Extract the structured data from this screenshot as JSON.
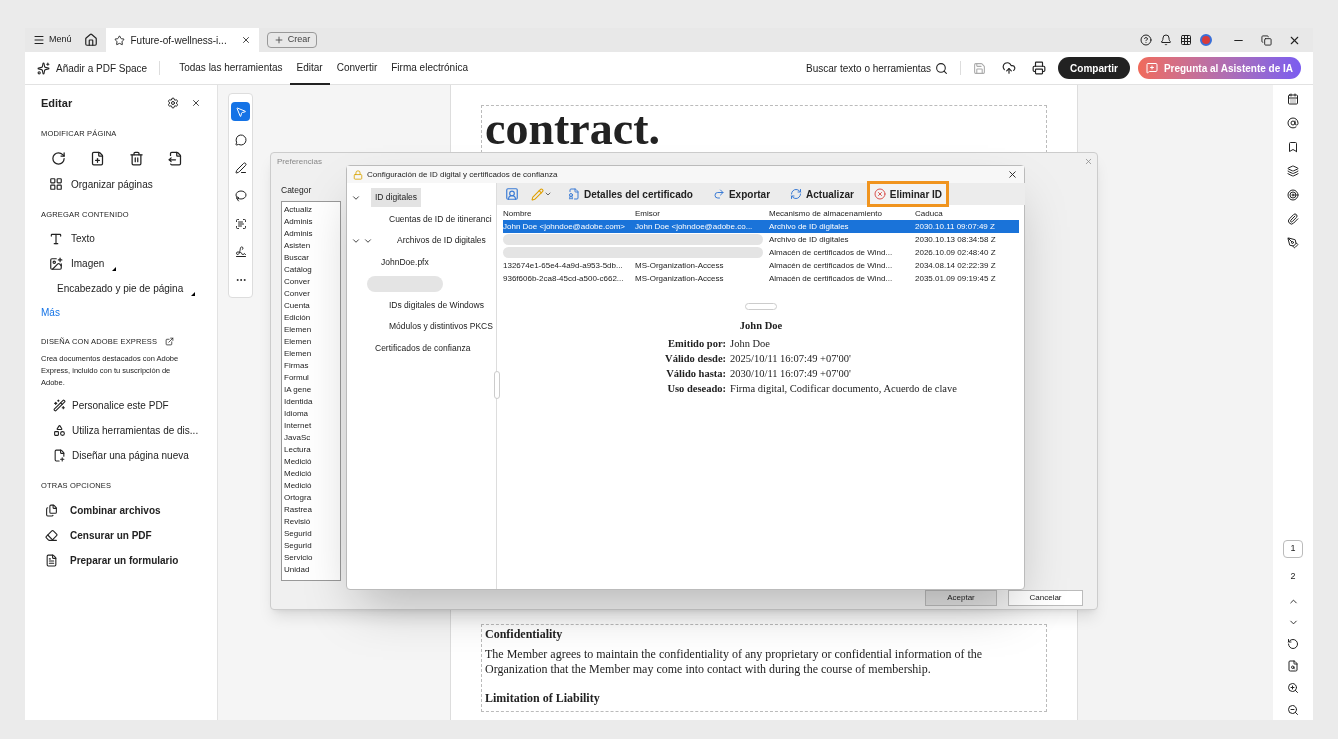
{
  "window": {
    "menu": "Menú",
    "tabs": [
      {
        "label": "Future-of-wellness-i...",
        "selected": true
      }
    ],
    "new_button": "Crear"
  },
  "toolbar": {
    "pdf_space": "Añadir a PDF Space",
    "nav": [
      {
        "label": "Todas las herramientas",
        "selected": false
      },
      {
        "label": "Editar",
        "selected": true
      },
      {
        "label": "Convertir",
        "selected": false
      },
      {
        "label": "Firma electrónica",
        "selected": false
      }
    ],
    "search": "Buscar texto o herramientas",
    "share": "Compartir",
    "assistant": "Pregunta al Asistente de IA"
  },
  "left_panel": {
    "title": "Editar",
    "sections": [
      {
        "heading": "MODIFICAR PÁGINA",
        "items": [
          {
            "kind": "icons"
          },
          {
            "kind": "tool",
            "label": "Organizar páginas",
            "submenu": false
          }
        ]
      },
      {
        "heading": "AGREGAR CONTENIDO",
        "items": [
          {
            "kind": "tool",
            "label": "Texto",
            "submenu": false
          },
          {
            "kind": "tool",
            "label": "Imagen",
            "submenu": true
          },
          {
            "kind": "tool",
            "label": "Encabezado y pie de página",
            "submenu": true
          },
          {
            "kind": "link",
            "label": "Más"
          }
        ]
      },
      {
        "heading": "DISEÑA CON ADOBE EXPRESS",
        "items": [
          {
            "kind": "note",
            "label": "Crea documentos destacados con Adobe Express, incluido con tu suscripción de Adobe."
          },
          {
            "kind": "indented",
            "label": "Personalice este PDF"
          },
          {
            "kind": "indented",
            "label": "Utiliza herramientas de dis..."
          },
          {
            "kind": "indented",
            "label": "Diseñar una página nueva"
          }
        ]
      },
      {
        "heading": "OTRAS OPCIONES",
        "items": [
          {
            "kind": "strong",
            "label": "Combinar archivos"
          },
          {
            "kind": "strong",
            "label": "Censurar un PDF"
          },
          {
            "kind": "strong",
            "label": "Preparar un formulario"
          }
        ]
      }
    ]
  },
  "tool_rail": [
    {
      "selected": true
    },
    {
      "selected": false
    },
    {
      "selected": false
    },
    {
      "selected": false
    },
    {
      "selected": false
    },
    {
      "selected": false
    },
    {
      "selected": false
    }
  ],
  "document": {
    "heading": "contract.",
    "section": "Confidentiality",
    "paragraph": "The Member agrees to maintain the confidentiality of any proprietary or confidential information of the Organization that the Member may come into contact with during the course of membership.",
    "subheading": "Limitation of Liability"
  },
  "preferences": {
    "title": "Preferencias",
    "categories_label": "Categor",
    "categories": [
      "Actualiz",
      "Adminis",
      "Adminis",
      "Asisten",
      "Buscar",
      "Catálog",
      "Conver",
      "Conver",
      "Cuenta",
      "Edición",
      "Elemen",
      "Elemen",
      "Elemen",
      "Firmas",
      "Formul",
      "IA gene",
      "Identida",
      "Idioma",
      "Internet",
      "JavaSc",
      "Lectura",
      "Medició",
      "Medició",
      "Medició",
      "Ortogra",
      "Rastrea",
      "Revisió",
      "Segurid",
      "Segurid",
      "Servicio",
      "Unidad"
    ],
    "ok": "Aceptar",
    "cancel": "Cancelar"
  },
  "id_dialog": {
    "title": "Configuración de ID digital y certificados de confianza",
    "tree": [
      {
        "kind": "item",
        "label": "ID digitales",
        "selected": true,
        "expanded": true,
        "children": [
          {
            "kind": "item",
            "label": "Cuentas de ID de itineranci",
            "selected": false
          },
          {
            "kind": "item",
            "label": "Archivos de ID digitales",
            "selected": false,
            "expanded": true,
            "children": [
              {
                "kind": "item",
                "label": "JohnDoe.pfx",
                "selected": false
              },
              {
                "kind": "redacted",
                "selected": false
              }
            ]
          },
          {
            "kind": "item",
            "label": "IDs digitales de Windows",
            "selected": false
          },
          {
            "kind": "item",
            "label": "Módulos y distintivos PKCS",
            "selected": false
          }
        ]
      },
      {
        "kind": "item",
        "label": "Certificados de confianza",
        "selected": false
      }
    ],
    "actions": [
      {
        "label": "Detalles del certificado",
        "highlighted": false
      },
      {
        "label": "Exportar",
        "highlighted": false
      },
      {
        "label": "Actualizar",
        "highlighted": false
      },
      {
        "label": "Eliminar ID",
        "highlighted": true
      }
    ],
    "columns": [
      "Nombre",
      "Emisor",
      "Mecanismo de almacenamiento",
      "Caduca"
    ],
    "rows": [
      {
        "selected": true,
        "redacted": false,
        "cells": [
          "John Doe <johndoe@adobe.com>",
          "John Doe <johndoe@adobe.co...",
          "Archivo de ID digitales",
          "2030.10.11 09:07:49 Z"
        ]
      },
      {
        "selected": false,
        "redacted": true,
        "cells": [
          "Archivo de ID digitales",
          "2030.10.13 08:34:58 Z"
        ]
      },
      {
        "selected": false,
        "redacted": true,
        "cells": [
          "Almacén de certificados de Wind...",
          "2026.10.09 02:48:40 Z"
        ]
      },
      {
        "selected": false,
        "redacted": false,
        "cells": [
          "132674e1-65e4-4a9d-a953-5db...",
          "MS-Organization-Access",
          "Almacén de certificados de Wind...",
          "2034.08.14 02:22:39 Z"
        ]
      },
      {
        "selected": false,
        "redacted": false,
        "cells": [
          "936f606b-2ca8-45cd-a500-c662...",
          "MS-Organization-Access",
          "Almacén de certificados de Wind...",
          "2035.01.09 09:19:45 Z"
        ]
      }
    ],
    "details": {
      "name": "John Doe",
      "fields": [
        {
          "label": "Emitido por:",
          "value": "John Doe"
        },
        {
          "label": "Válido desde:",
          "value": "2025/10/11 16:07:49 +07'00'"
        },
        {
          "label": "Válido hasta:",
          "value": "2030/10/11 16:07:49 +07'00'"
        },
        {
          "label": "Uso deseado:",
          "value": "Firma digital, Codificar documento, Acuerdo de clave"
        }
      ]
    }
  },
  "page_nav": {
    "pages": [
      {
        "label": "1",
        "selected": true
      },
      {
        "label": "2",
        "selected": false
      }
    ]
  }
}
